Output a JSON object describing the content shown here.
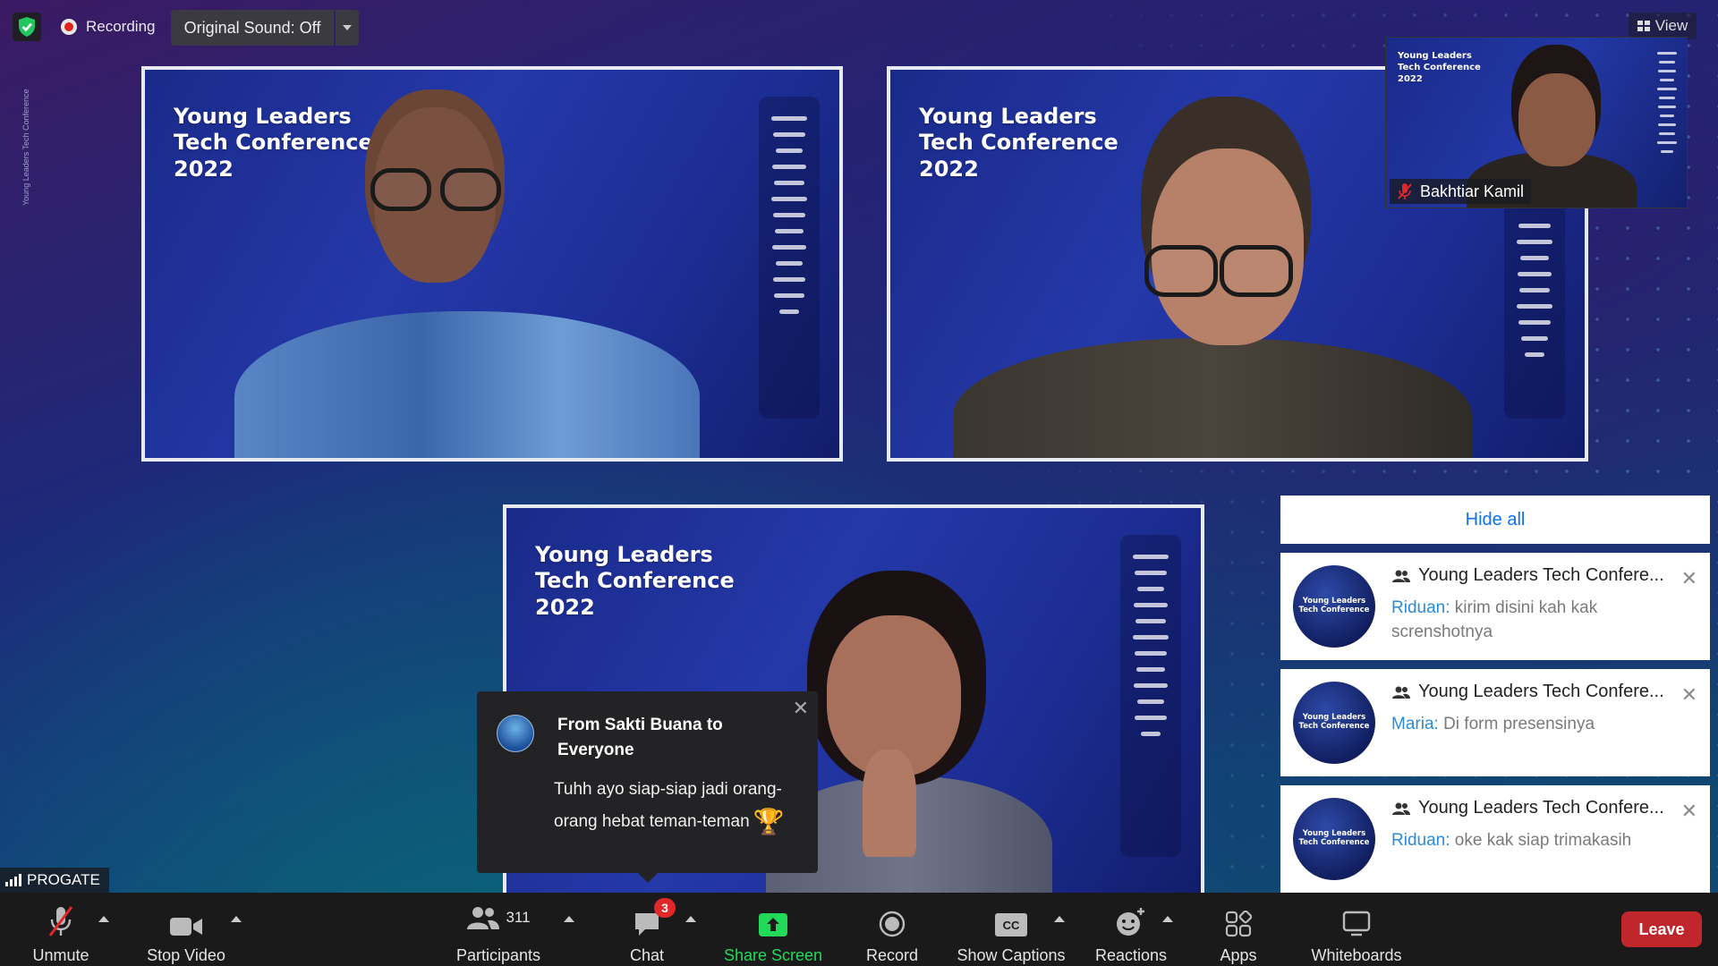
{
  "topbar": {
    "recording_label": "Recording",
    "original_sound": "Original Sound: Off",
    "view_label": "View",
    "vertical_label": "Young Leaders Tech Conference"
  },
  "conference_brand": {
    "line1": "Young Leaders",
    "line2": "Tech Conference",
    "line3": "2022"
  },
  "self_view": {
    "name": "Bakhtiar Kamil",
    "muted": true
  },
  "speaker_tag": {
    "name": "PROGATE"
  },
  "chat_popup": {
    "from": "From Sakti Buana to Everyone",
    "message": "Tuhh ayo siap-siap jadi orang-orang hebat teman-teman",
    "emoji": "trophy"
  },
  "notifications": {
    "hide_all": "Hide all",
    "items": [
      {
        "title": "Young Leaders Tech Confere...",
        "sender": "Riduan:",
        "text": "kirim disini kah kak screnshotnya"
      },
      {
        "title": "Young Leaders Tech Confere...",
        "sender": "Maria:",
        "text": "Di form presensinya"
      },
      {
        "title": "Young Leaders Tech Confere...",
        "sender": "Riduan:",
        "text": "oke kak siap trimakasih"
      }
    ],
    "avatar_line1": "Young Leaders",
    "avatar_line2": "Tech Conference"
  },
  "toolbar": {
    "unmute": "Unmute",
    "stop_video": "Stop Video",
    "participants": "Participants",
    "participants_count": "311",
    "chat": "Chat",
    "chat_badge": "3",
    "share_screen": "Share Screen",
    "record": "Record",
    "show_captions": "Show Captions",
    "reactions": "Reactions",
    "apps": "Apps",
    "whiteboards": "Whiteboards",
    "leave": "Leave"
  },
  "colors": {
    "share_green": "#23d959",
    "leave_red": "#c0272d",
    "link_blue": "#0e72ed",
    "badge_red": "#e02828"
  }
}
